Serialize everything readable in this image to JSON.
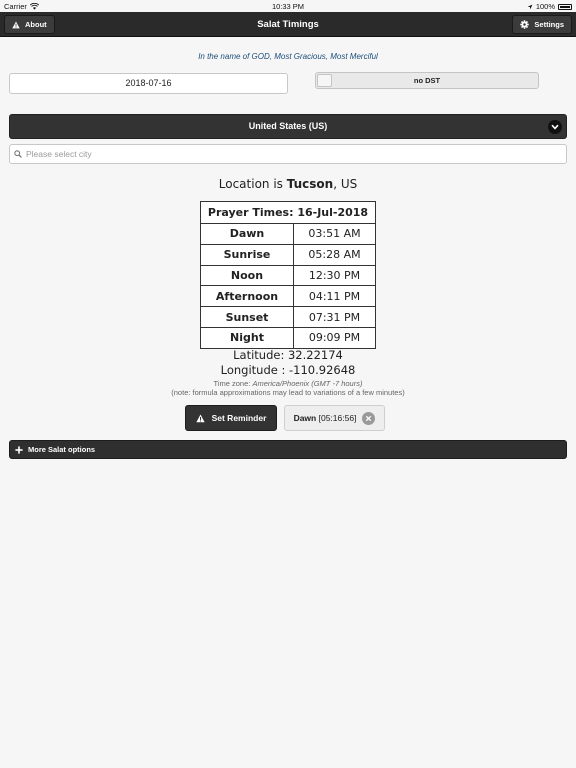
{
  "status_bar": {
    "carrier": "Carrier",
    "time": "10:33 PM",
    "battery": "100%"
  },
  "header": {
    "title": "Salat Timings",
    "about_label": "About",
    "settings_label": "Settings"
  },
  "blessing": "In the name of GOD, Most Gracious, Most Merciful",
  "date": {
    "value": "2018-07-16"
  },
  "dst": {
    "label": "no DST"
  },
  "country": {
    "selected": "United States (US)"
  },
  "city_search": {
    "placeholder": "Please select city"
  },
  "location": {
    "prefix": "Location is",
    "city": "Tucson",
    "country": ", US"
  },
  "prayer_table": {
    "header": "Prayer Times: 16-Jul-2018",
    "rows": [
      {
        "name": "Dawn",
        "time": "03:51 AM"
      },
      {
        "name": "Sunrise",
        "time": "05:28 AM"
      },
      {
        "name": "Noon",
        "time": "12:30 PM"
      },
      {
        "name": "Afternoon",
        "time": "04:11 PM"
      },
      {
        "name": "Sunset",
        "time": "07:31 PM"
      },
      {
        "name": "Night",
        "time": "09:09 PM"
      }
    ]
  },
  "coordinates": {
    "latitude": "Latitude: 32.22174",
    "longitude": "Longitude : -110.92648"
  },
  "timezone": {
    "prefix": "Time zone:",
    "zone": "America/Phoenix (GMT -7 hours)"
  },
  "note": "(note: formula approximations may lead to variations of a few minutes)",
  "reminder": {
    "button_label": "Set Reminder",
    "next_prayer": "Dawn",
    "countdown": "[05:16:56]"
  },
  "more_options_label": "More Salat options",
  "icons": {
    "about": "warning-icon",
    "settings": "gear-icon",
    "country_select": "chevron-down-icon",
    "search": "search-icon",
    "reminder": "warning-icon",
    "clear": "close-icon",
    "more": "plus-icon"
  }
}
